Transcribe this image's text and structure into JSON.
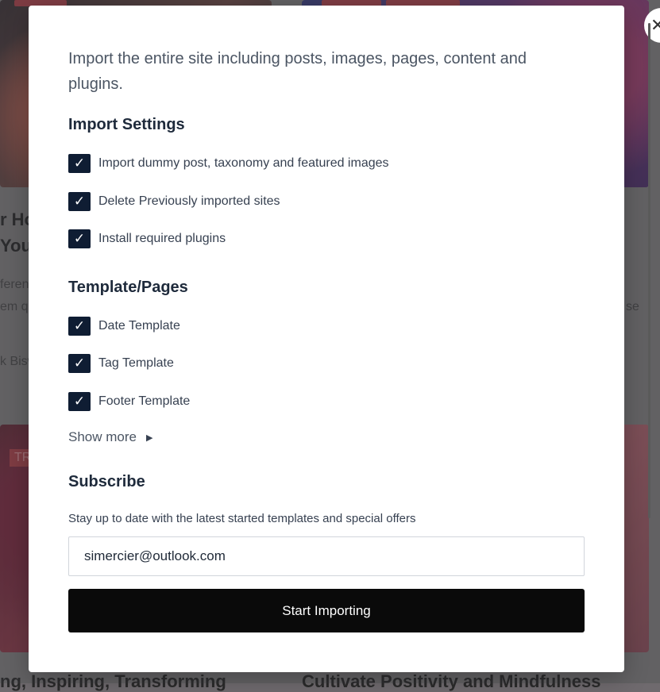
{
  "background": {
    "headline_left_1": "r Ho",
    "headline_left_2": "You",
    "excerpt_left_1": "feren",
    "excerpt_left_2": "em qu",
    "excerpt_right": "se",
    "author_left": "k Bisw",
    "tag_left": "TR",
    "bottom_title_left": "ng, Inspiring, Transforming",
    "bottom_title_right": "Cultivate Positivity and Mindfulness"
  },
  "close": {
    "icon": "close-icon",
    "symbol": "✕"
  },
  "modal": {
    "intro": "Import the entire site including posts, images, pages, content and plugins.",
    "import_settings": {
      "title": "Import Settings",
      "options": [
        {
          "label": "Import dummy post, taxonomy and featured images",
          "checked": true
        },
        {
          "label": "Delete Previously imported sites",
          "checked": true
        },
        {
          "label": "Install required plugins",
          "checked": true
        }
      ]
    },
    "templates": {
      "title": "Template/Pages",
      "options": [
        {
          "label": "Date Template",
          "checked": true
        },
        {
          "label": "Tag Template",
          "checked": true
        },
        {
          "label": "Footer Template",
          "checked": true
        }
      ],
      "show_more": "Show more"
    },
    "subscribe": {
      "title": "Subscribe",
      "description": "Stay up to date with the latest started templates and special offers",
      "email_value": "simercier@outlook.com"
    },
    "start_button": "Start Importing",
    "check_symbol": "✓"
  }
}
